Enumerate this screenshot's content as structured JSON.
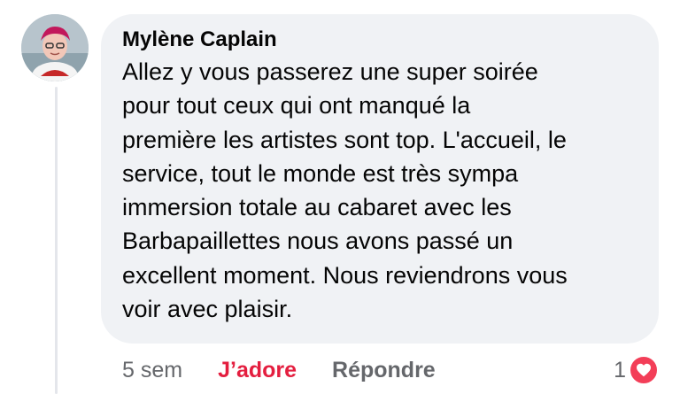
{
  "comment": {
    "author": "Mylène Caplain",
    "text": "Allez y vous passerez une super soirée\npour tout ceux qui ont manqué la\npremière les artistes sont top. L'accueil, le\nservice, tout le monde est très sympa\nimmersion totale au cabaret avec les\nBarbapaillettes nous avons passé un\nexcellent moment. Nous reviendrons vous\nvoir avec plaisir."
  },
  "actions": {
    "timestamp": "5 sem",
    "like_label": "J’adore",
    "reply_label": "Répondre"
  },
  "reactions": {
    "count": "1",
    "icon": "heart-icon"
  },
  "colors": {
    "bubble": "#f0f2f5",
    "like_active": "#e41e3f",
    "heart": "#f33e58",
    "muted": "#65676b"
  }
}
